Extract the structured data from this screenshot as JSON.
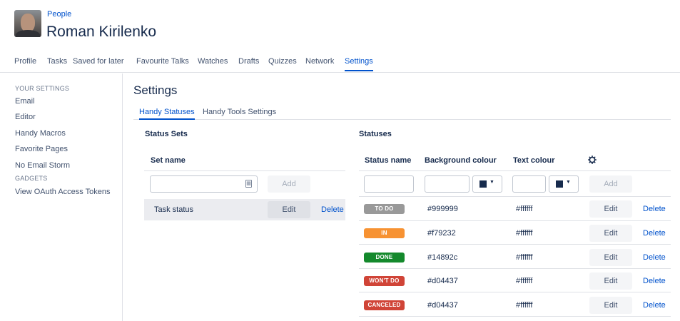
{
  "header": {
    "breadcrumb": "People",
    "name": "Roman Kirilenko"
  },
  "nav": {
    "tabs": [
      "Profile",
      "Tasks",
      "Saved for later",
      "Favourite Talks",
      "Watches",
      "Drafts",
      "Quizzes",
      "Network",
      "Settings"
    ],
    "active": "Settings"
  },
  "sidebar": {
    "your_settings_heading": "YOUR SETTINGS",
    "items": [
      "Email",
      "Editor",
      "Handy Macros",
      "Favorite Pages",
      "No Email Storm"
    ],
    "gadgets_heading": "GADGETS",
    "gadget_items": [
      "View OAuth Access Tokens"
    ]
  },
  "main": {
    "title": "Settings",
    "subtabs": [
      "Handy Statuses",
      "Handy Tools Settings"
    ],
    "active_subtab": "Handy Statuses"
  },
  "status_sets": {
    "heading": "Status Sets",
    "column": "Set name",
    "input_value": "",
    "add_label": "Add",
    "rows": [
      {
        "name": "Task status",
        "edit_label": "Edit",
        "delete_label": "Delete"
      }
    ]
  },
  "statuses": {
    "heading": "Statuses",
    "columns": {
      "name": "Status name",
      "background": "Background colour",
      "text": "Text colour"
    },
    "add_label": "Add",
    "rows": [
      {
        "label": "TO DO",
        "background": "#999999",
        "text": "#ffffff",
        "edit_label": "Edit",
        "delete_label": "Delete"
      },
      {
        "label": "IN PROGRESS",
        "background": "#f79232",
        "text": "#ffffff",
        "edit_label": "Edit",
        "delete_label": "Delete"
      },
      {
        "label": "DONE",
        "background": "#14892c",
        "text": "#ffffff",
        "edit_label": "Edit",
        "delete_label": "Delete"
      },
      {
        "label": "WON'T DO",
        "background": "#d04437",
        "text": "#ffffff",
        "edit_label": "Edit",
        "delete_label": "Delete"
      },
      {
        "label": "CANCELED",
        "background": "#d04437",
        "text": "#ffffff",
        "edit_label": "Edit",
        "delete_label": "Delete"
      }
    ]
  },
  "colors": {
    "link": "#0052cc",
    "text": "#172b4d"
  },
  "icons": {
    "avatar": "user-photo",
    "calendar": "calendar-icon",
    "gear": "gear-icon",
    "caret": "chevron-down-icon"
  }
}
